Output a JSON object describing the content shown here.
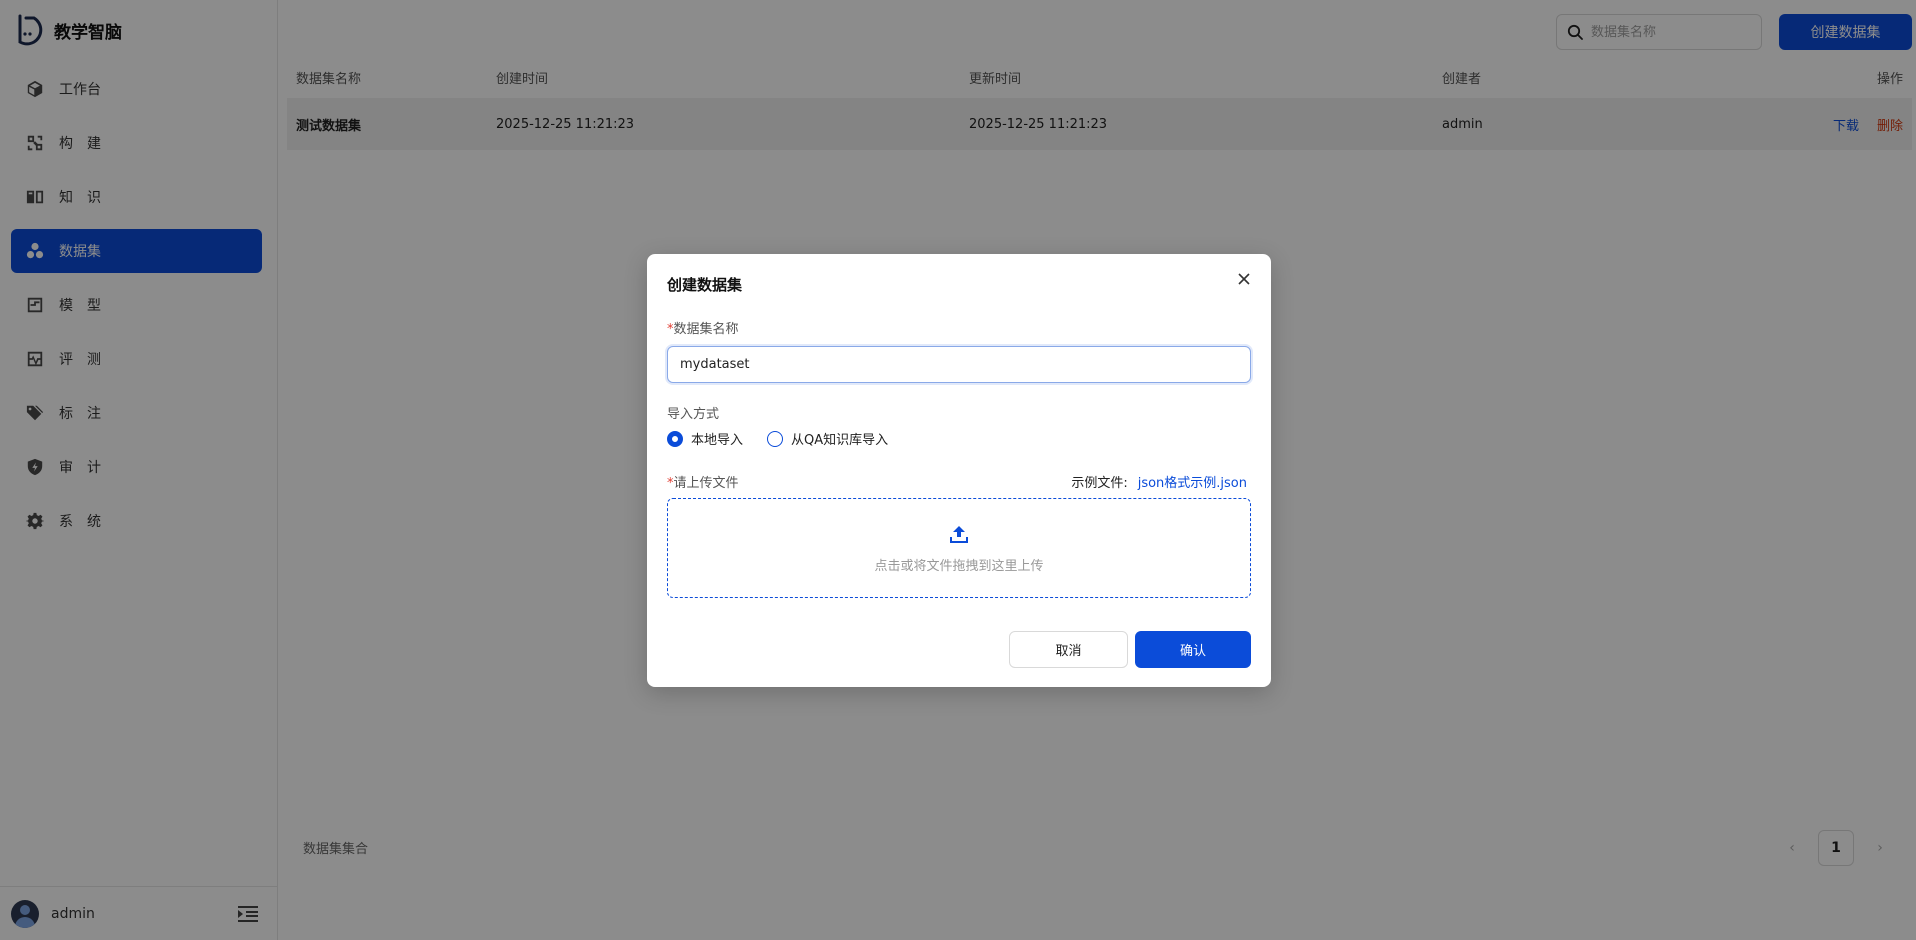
{
  "app": {
    "name": "教学智脑",
    "accent": "#0b4cd9"
  },
  "sidebar": {
    "items": [
      {
        "label": "工作台",
        "icon": "cube-icon",
        "active": false
      },
      {
        "label": "构建",
        "icon": "build-icon",
        "active": false
      },
      {
        "label": "知识",
        "icon": "book-icon",
        "active": false
      },
      {
        "label": "数据集",
        "icon": "dataset-icon",
        "active": true
      },
      {
        "label": "模型",
        "icon": "model-icon",
        "active": false
      },
      {
        "label": "评测",
        "icon": "pulse-icon",
        "active": false
      },
      {
        "label": "标注",
        "icon": "tag-icon",
        "active": false
      },
      {
        "label": "审计",
        "icon": "shield-icon",
        "active": false
      },
      {
        "label": "系统",
        "icon": "gear-icon",
        "active": false
      }
    ],
    "user": "admin"
  },
  "toolbar": {
    "search_placeholder": "数据集名称",
    "create_label": "创建数据集"
  },
  "table": {
    "columns": [
      "数据集名称",
      "创建时间",
      "更新时间",
      "创建者",
      "操作"
    ],
    "rows": [
      {
        "name": "测试数据集",
        "created": "2025-12-25 11:21:23",
        "updated": "2025-12-25 11:21:23",
        "creator": "admin",
        "download": "下载",
        "delete": "删除"
      }
    ]
  },
  "footer": {
    "summary": "数据集集合",
    "current_page": "1",
    "prev": "‹",
    "next": "›"
  },
  "modal": {
    "title": "创建数据集",
    "name_label": "数据集名称",
    "name_value": "mydataset",
    "import_label": "导入方式",
    "options": [
      "本地导入",
      "从QA知识库导入"
    ],
    "selected_option": "本地导入",
    "upload_label": "请上传文件",
    "example_prefix": "示例文件:",
    "example_link": "json格式示例.json",
    "drop_hint": "点击或将文件拖拽到这里上传",
    "cancel": "取消",
    "confirm": "确认",
    "required_mark": "*"
  }
}
